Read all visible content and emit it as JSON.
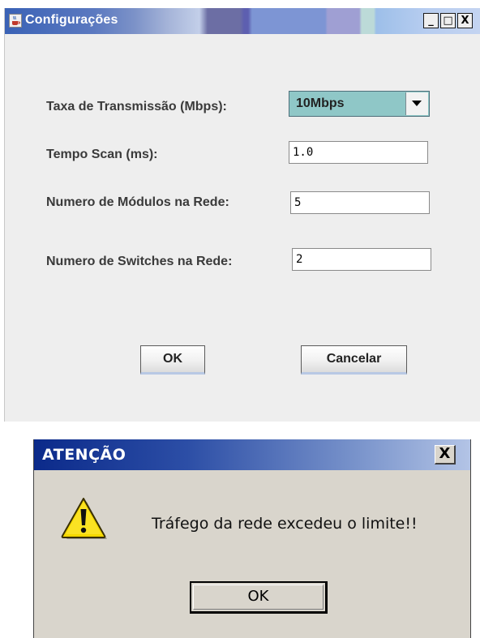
{
  "config_dialog": {
    "title": "Configurações",
    "icon": "java-coffee-icon",
    "window_buttons": {
      "minimize": "_",
      "maximize": "□",
      "close": "X"
    },
    "fields": {
      "taxa": {
        "label": "Taxa de Transmissão (Mbps):",
        "value": "10Mbps"
      },
      "tempo_scan": {
        "label": "Tempo Scan (ms):",
        "value": "1.0"
      },
      "modulos": {
        "label": "Numero de Módulos na Rede:",
        "value": "5"
      },
      "switches": {
        "label": "Numero de Switches na Rede:",
        "value": "2"
      }
    },
    "buttons": {
      "ok": "OK",
      "cancel": "Cancelar"
    },
    "colors": {
      "combo_bg": "#8fc7c7",
      "window_bg": "#eeeeee"
    }
  },
  "alert_dialog": {
    "title": "ATENÇÃO",
    "close_label": "X",
    "icon": "warning-icon",
    "message": "Tráfego da rede excedeu o limite!!",
    "ok_label": "OK",
    "colors": {
      "titlebar_start": "#0b2a8a",
      "body_bg": "#d9d5cc"
    }
  }
}
